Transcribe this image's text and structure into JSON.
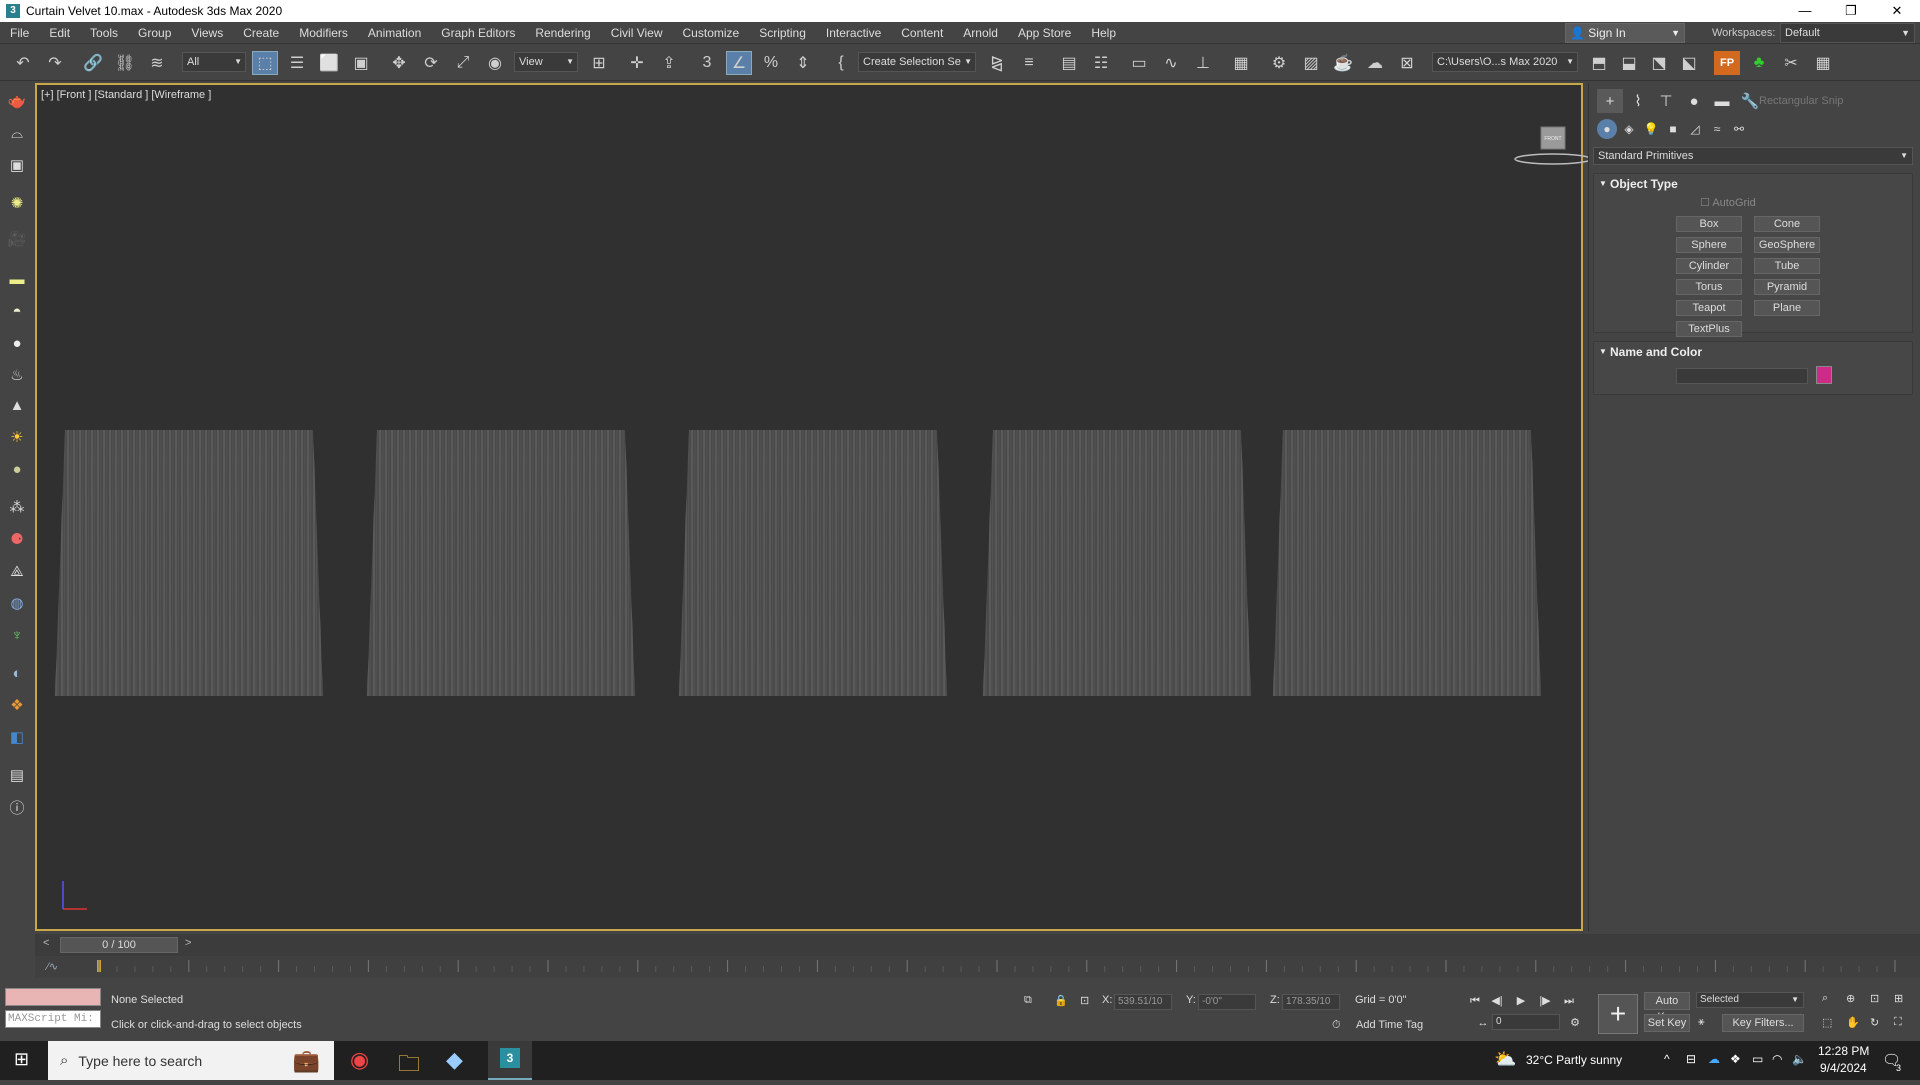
{
  "window": {
    "title": "Curtain Velvet 10.max - Autodesk 3ds Max 2020",
    "app_icon": "3ds-max-icon",
    "minimize": "—",
    "restore": "❐",
    "close": "✕"
  },
  "menu": {
    "items": [
      "File",
      "Edit",
      "Tools",
      "Group",
      "Views",
      "Create",
      "Modifiers",
      "Animation",
      "Graph Editors",
      "Rendering",
      "Civil View",
      "Customize",
      "Scripting",
      "Interactive",
      "Content",
      "Arnold",
      "App Store",
      "Help"
    ],
    "sign_in": "Sign In",
    "workspaces_label": "Workspaces:",
    "workspace_value": "Default"
  },
  "toolbar": {
    "selection_filter": "All",
    "ref_coord": "View",
    "named_selection": "Create Selection Se",
    "project_path": "C:\\Users\\O...s Max 2020"
  },
  "viewport": {
    "label": "[+] [Front ] [Standard ] [Wireframe ]",
    "viewcube_label": "FRONT"
  },
  "command_panel": {
    "search_placeholder": "Rectangular Snip",
    "category": "Standard Primitives",
    "object_type_title": "Object Type",
    "autogrid_label": "AutoGrid",
    "object_buttons": [
      "Box",
      "Cone",
      "Sphere",
      "GeoSphere",
      "Cylinder",
      "Tube",
      "Torus",
      "Pyramid",
      "Teapot",
      "Plane",
      "TextPlus"
    ],
    "name_color_title": "Name and Color",
    "name_value": "",
    "object_color": "#cc2b88"
  },
  "timeline": {
    "frame_display": "0 / 100",
    "prev": "<",
    "next": ">",
    "ticks": [
      0,
      5,
      10,
      15,
      20,
      25,
      30,
      35,
      40,
      45,
      50,
      55,
      60,
      65,
      70,
      75,
      80,
      85,
      90,
      95,
      100
    ]
  },
  "status": {
    "selection_status": "None Selected",
    "prompt": "Click or click-and-drag to select objects",
    "maxscript_placeholder": "MAXScript Mi:",
    "x_label": "X:",
    "x_value": "539.51/10",
    "y_label": "Y:",
    "y_value": "-0'0\"",
    "z_label": "Z:",
    "z_value": "178.35/10",
    "grid": "Grid = 0'0\"",
    "add_time_tag": "Add Time Tag",
    "auto_key": "Auto Key",
    "set_key": "Set Key",
    "key_mode": "Selected",
    "key_filters": "Key Filters...",
    "current_frame": "0"
  },
  "taskbar": {
    "search_placeholder": "Type here to search",
    "weather": "32°C  Partly sunny",
    "time": "12:28 PM",
    "date": "9/4/2024",
    "notification_count": "3"
  }
}
